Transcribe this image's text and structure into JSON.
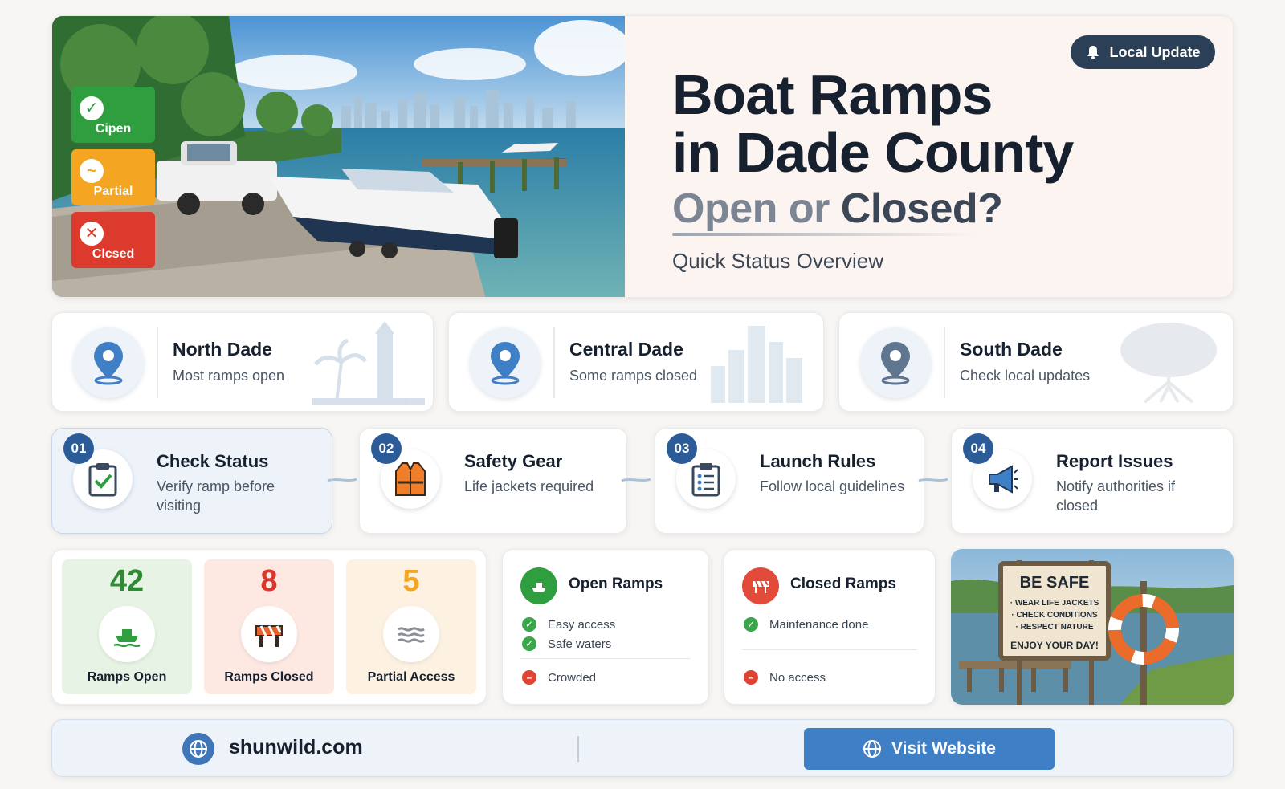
{
  "hero": {
    "title_line1": "Boat Ramps",
    "title_line2": "in Dade County",
    "subtitle_part1": "Open or ",
    "subtitle_part2": "Closed?",
    "overview": "Quick Status Overview",
    "badge": "Local Update",
    "image_chips": [
      {
        "label": "Cipen",
        "icon": "check-icon",
        "color": "#2f9e3f"
      },
      {
        "label": "Partial",
        "icon": "wave-icon",
        "color": "#f4a623"
      },
      {
        "label": "Clcsed",
        "icon": "x-icon",
        "color": "#dc3a2c"
      }
    ]
  },
  "regions": [
    {
      "name": "North Dade",
      "desc": "Most ramps open",
      "icon": "map-pin-icon"
    },
    {
      "name": "Central Dade",
      "desc": "Some ramps closed",
      "icon": "map-pin-icon"
    },
    {
      "name": "South Dade",
      "desc": "Check local updates",
      "icon": "map-pin-icon"
    }
  ],
  "steps": [
    {
      "num": "01",
      "title": "Check Status",
      "desc": "Verify ramp before visiting",
      "icon": "clipboard-check-icon"
    },
    {
      "num": "02",
      "title": "Safety Gear",
      "desc": "Life jackets required",
      "icon": "life-jacket-icon"
    },
    {
      "num": "03",
      "title": "Launch Rules",
      "desc": "Follow local guidelines",
      "icon": "checklist-icon"
    },
    {
      "num": "04",
      "title": "Report Issues",
      "desc": "Notify authorities if closed",
      "icon": "megaphone-icon"
    }
  ],
  "stats": [
    {
      "value": "42",
      "label": "Ramps Open",
      "icon": "boat-icon",
      "color": "#2f8a36"
    },
    {
      "value": "8",
      "label": "Ramps Closed",
      "icon": "barrier-icon",
      "color": "#d8372a"
    },
    {
      "value": "5",
      "label": "Partial Access",
      "icon": "waves-icon",
      "color": "#f4a623"
    }
  ],
  "open_list": {
    "title": "Open Ramps",
    "items": [
      "Easy access",
      "Safe waters"
    ],
    "negative": [
      "Crowded"
    ]
  },
  "closed_list": {
    "title": "Closed Ramps",
    "items": [
      "Maintenance done"
    ],
    "negative": [
      "No access"
    ]
  },
  "sign": {
    "heading": "BE SAFE",
    "lines": [
      "· WEAR LIFE JACKETS",
      "· CHECK CONDITIONS",
      "· RESPECT NATURE"
    ],
    "footer": "ENJOY YOUR DAY!"
  },
  "footer": {
    "site": "shunwild.com",
    "button": "Visit Website"
  },
  "colors": {
    "open": "#2f9e3f",
    "partial": "#f4a623",
    "closed": "#dc3a2c",
    "primary": "#3f7fc6",
    "dark": "#16202e"
  }
}
